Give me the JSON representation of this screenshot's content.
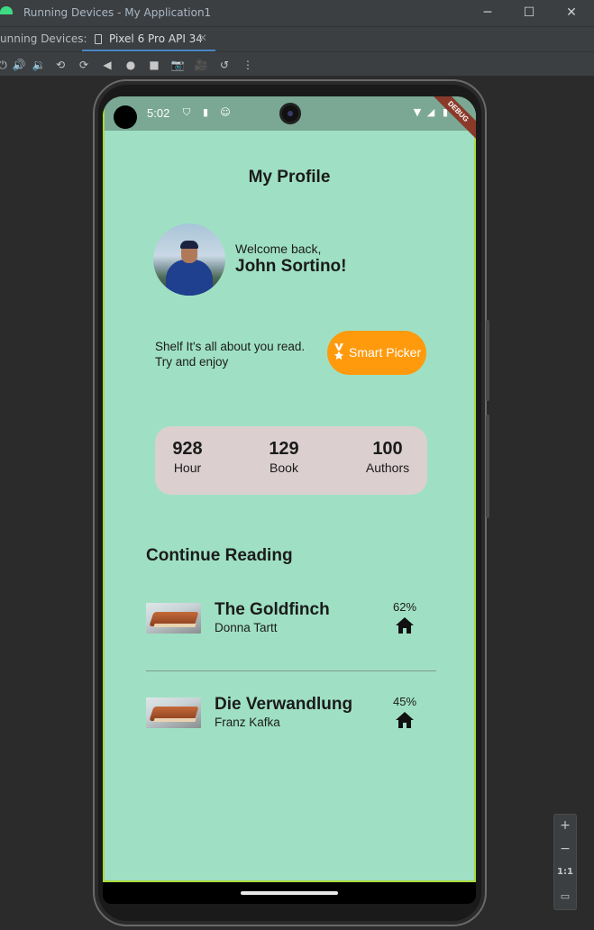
{
  "window": {
    "title": "Running Devices - My Application1",
    "controls": {
      "minimize": "─",
      "maximize": "☐",
      "close": "✕"
    }
  },
  "tabbar": {
    "label": "unning Devices:",
    "tab_label": "Pixel 6 Pro API 34",
    "tab_close": "✕"
  },
  "toolbar": {
    "tools": [
      "power-icon",
      "volume-up-icon",
      "volume-down-icon",
      "rotate-left-icon",
      "rotate-right-icon",
      "back-icon",
      "home-icon",
      "overview-icon",
      "screenshot-icon",
      "screen-record-icon",
      "snapshot-icon",
      "more-icon"
    ]
  },
  "device": {
    "status": {
      "time": "5:02"
    },
    "debug_banner": "DEBUG"
  },
  "profile": {
    "page_title": "My Profile",
    "welcome": "Welcome back,",
    "username": "John Sortino!",
    "tagline_line1": "Shelf It's all about you read.",
    "tagline_line2": "Try and enjoy",
    "smart_picker_label": "Smart Picker"
  },
  "stats": [
    {
      "value": "928",
      "label": "Hour"
    },
    {
      "value": "129",
      "label": "Book"
    },
    {
      "value": "100",
      "label": "Authors"
    }
  ],
  "continue_reading": {
    "title": "Continue Reading",
    "books": [
      {
        "title": "The Goldfinch",
        "author": "Donna Tartt",
        "progress": "62%"
      },
      {
        "title": "Die Verwandlung",
        "author": "Franz Kafka",
        "progress": "45%"
      }
    ]
  },
  "zoom_controls": {
    "zoom_in": "+",
    "zoom_out": "−",
    "actual_size": "1:1"
  },
  "colors": {
    "app_background": "#9fe0c4",
    "accent_orange": "#ff9a0d",
    "stats_card": "#dbcfd0",
    "ide_chrome": "#3c3f41"
  }
}
